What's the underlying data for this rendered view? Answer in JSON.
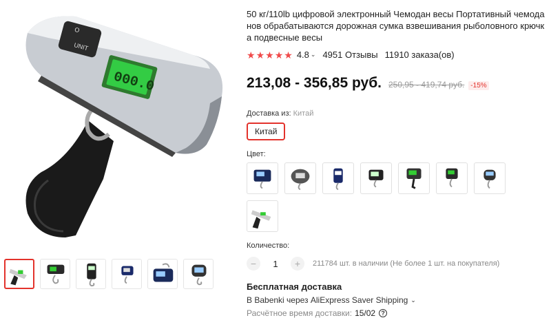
{
  "product": {
    "title": "50 кг/110lb цифровой электронный Чемодан весы Портативный чемоданов обрабатываются дорожная сумка взвешивания рыболовного крючка подвесные весы",
    "rating": "4.8",
    "reviews": "4951 Отзывы",
    "orders": "11910 заказа(ов)",
    "stars": 5,
    "price": "213,08 - 356,85 руб.",
    "old_price": "250,95 - 419,74 руб.",
    "discount": "-15%"
  },
  "shipping_from": {
    "label": "Доставка из:",
    "value": "Китай",
    "selected_option": "Китай"
  },
  "color": {
    "label": "Цвет:",
    "options": [
      "black-blue",
      "round-gray",
      "blue-black",
      "black-lcd",
      "green-lcd",
      "green-black",
      "silver-strap"
    ]
  },
  "quantity": {
    "label": "Количество:",
    "minus": "−",
    "value": "1",
    "plus": "+",
    "stock": "211784 шт. в наличии (Не более 1 шт. на покупателя)"
  },
  "delivery": {
    "free": "Бесплатная доставка",
    "carrier": "В Babenki через AliExpress Saver Shipping",
    "estimate_label": "Расчётное время доставки:",
    "estimate_date": "15/02"
  },
  "gallery": {
    "display": "000.0",
    "buttons": [
      "O",
      "UNIT"
    ],
    "thumbnails": 6
  },
  "colors": {
    "accent": "#e3322b",
    "star": "#f04a4a"
  }
}
